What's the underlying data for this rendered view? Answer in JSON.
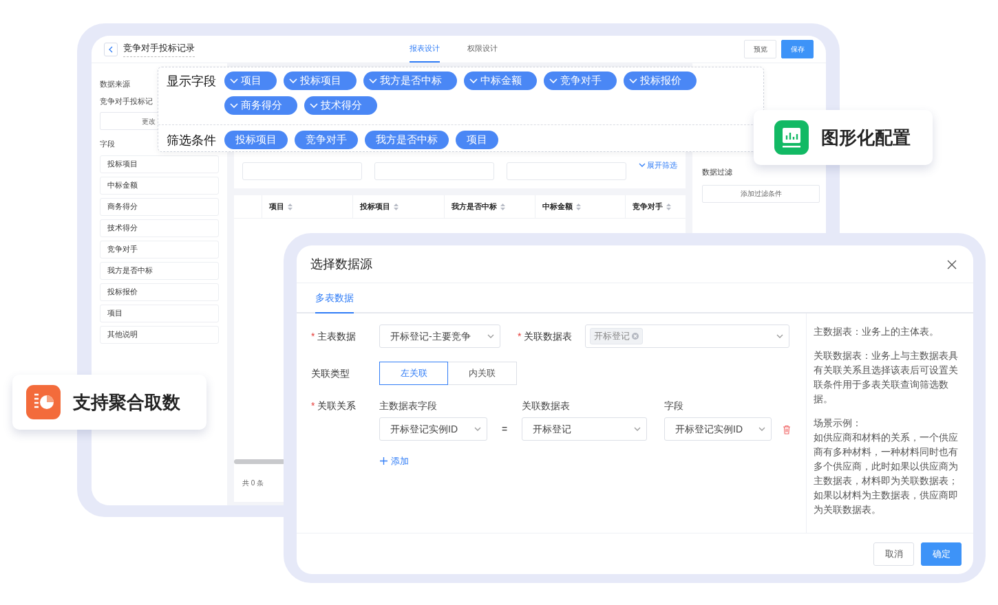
{
  "editor": {
    "title": "竞争对手投标记录",
    "tabs": [
      {
        "label": "报表设计",
        "selected": true
      },
      {
        "label": "权限设计",
        "selected": false
      }
    ],
    "buttons": [
      {
        "label": "预览",
        "kind": "default"
      },
      {
        "label": "保存",
        "kind": "primary"
      }
    ],
    "sidebar": {
      "source_label": "数据来源",
      "source_value": "竞争对手投标记",
      "change_button": "更改",
      "fields_label": "字段",
      "fields": [
        "投标项目",
        "中标金额",
        "商务得分",
        "技术得分",
        "竞争对手",
        "我方是否中标",
        "投标报价",
        "项目",
        "其他说明"
      ]
    },
    "filter_panel": {
      "expand_link": "展开筛选"
    },
    "table": {
      "columns": [
        "项目",
        "投标项目",
        "我方是否中标",
        "中标金额",
        "竞争对手"
      ],
      "footer": "共 0 条"
    },
    "right_panel": {
      "title": "数据过滤",
      "button": "添加过滤条件"
    }
  },
  "chip_popup": {
    "display_label": "显示字段",
    "display_chips": [
      "项目",
      "投标项目",
      "我方是否中标",
      "中标金额",
      "竞争对手",
      "投标报价",
      "商务得分",
      "技术得分"
    ],
    "filter_label": "筛选条件",
    "filter_chips": [
      "投标项目",
      "竞争对手",
      "我方是否中标",
      "项目"
    ]
  },
  "callouts": [
    {
      "text": "图形化配置",
      "kind": "chart"
    },
    {
      "text": "支持聚合取数",
      "kind": "pie"
    }
  ],
  "dialog": {
    "title": "选择数据源",
    "tabs": [
      {
        "label": "多表数据",
        "selected": true
      }
    ],
    "main_table": {
      "required_mark": "*",
      "label": "主表数据",
      "value": "开标登记-主要竞争"
    },
    "related_tables": {
      "required_mark": "*",
      "label": "关联数据表",
      "tags": [
        "开标登记"
      ]
    },
    "join_type": {
      "label": "关联类型",
      "options": [
        {
          "label": "左关联",
          "selected": true
        },
        {
          "label": "内关联",
          "selected": false
        }
      ]
    },
    "relation": {
      "required_mark": "*",
      "label": "关联关系",
      "headers": [
        "主数据表字段",
        "关联数据表",
        "字段"
      ],
      "main_field": "开标登记实例ID",
      "operator": "=",
      "related_table": "开标登记",
      "field": "开标登记实例ID",
      "add_link": "添加"
    },
    "help": [
      "主数据表：业务上的主体表。",
      "关联数据表：业务上与主数据表具有关联关系且选择该表后可设置关联条件用于多表关联查询筛选数据。",
      "场景示例：",
      "如供应商和材料的关系，一个供应商有多种材料，一种材料同时也有多个供应商，此时如果以供应商为主数据表，材料即为关联数据表；如果以材料为主数据表，供应商即为关联数据表。"
    ],
    "buttons": [
      {
        "label": "取消",
        "kind": "default"
      },
      {
        "label": "确定",
        "kind": "primary"
      }
    ]
  }
}
